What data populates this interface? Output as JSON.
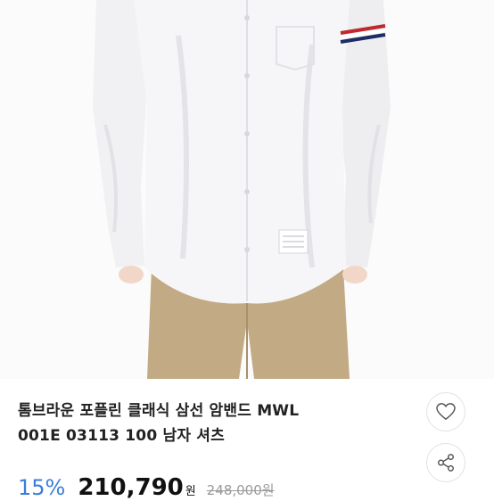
{
  "product": {
    "title_line1": "톰브라운 포플린 클래식 삼선 암밴드 MWL",
    "title_line2": "001E 03113 100 남자 셔츠",
    "image_icon": "product-photo-white-shirt"
  },
  "price": {
    "discount": "15%",
    "sale": "210,790",
    "currency": "원",
    "original": "248,000원"
  },
  "actions": {
    "like_icon": "heart-outline-icon",
    "share_icon": "share-icon"
  },
  "colors": {
    "discount": "#3b7ddd",
    "price": "#111111",
    "original": "#9a9a9a",
    "stripe_red": "#c0282d",
    "stripe_blue": "#1d2c64"
  }
}
